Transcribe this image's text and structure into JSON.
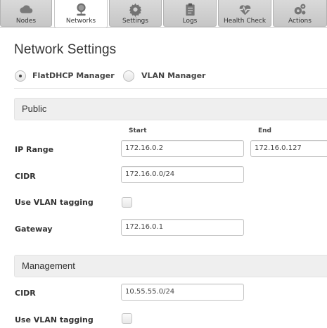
{
  "tabs": [
    {
      "label": "Nodes",
      "icon": "cloud-icon",
      "active": false
    },
    {
      "label": "Networks",
      "icon": "network-icon",
      "active": true
    },
    {
      "label": "Settings",
      "icon": "gear-icon",
      "active": false
    },
    {
      "label": "Logs",
      "icon": "clipboard-icon",
      "active": false
    },
    {
      "label": "Health Check",
      "icon": "heartbeat-icon",
      "active": false
    },
    {
      "label": "Actions",
      "icon": "gears-icon",
      "active": false
    }
  ],
  "page_title": "Network Settings",
  "manager": {
    "options": [
      "FlatDHCP Manager",
      "VLAN Manager"
    ],
    "selected": "FlatDHCP Manager"
  },
  "public": {
    "title": "Public",
    "start_header": "Start",
    "end_header": "End",
    "ip_range_label": "IP Range",
    "ip_start": "172.16.0.2",
    "ip_end": "172.16.0.127",
    "cidr_label": "CIDR",
    "cidr": "172.16.0.0/24",
    "vlan_label": "Use VLAN tagging",
    "vlan_checked": false,
    "gateway_label": "Gateway",
    "gateway": "172.16.0.1"
  },
  "management": {
    "title": "Management",
    "cidr_label": "CIDR",
    "cidr": "10.55.55.0/24",
    "vlan_label": "Use VLAN tagging",
    "vlan_checked": false
  },
  "colors": {
    "tab_bg": "#c6c6c6",
    "section_bg": "#efefef",
    "text": "#333333"
  }
}
